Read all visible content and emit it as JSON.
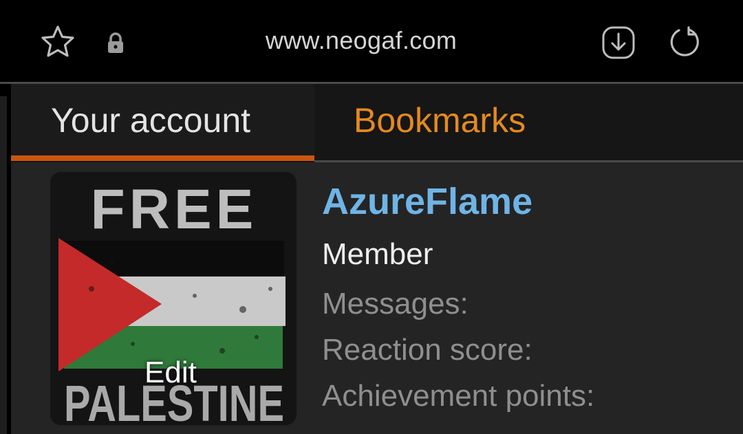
{
  "browser": {
    "url": "www.neogaf.com",
    "icons": {
      "bookmark": "star-outline-icon",
      "secure": "lock-icon",
      "download": "download-circle-icon",
      "reload": "reload-icon"
    }
  },
  "tabs": [
    {
      "label": "Your account",
      "active": true
    },
    {
      "label": "Bookmarks",
      "active": false
    }
  ],
  "profile": {
    "avatar_text_top": "FREE",
    "avatar_text_bottom": "PALESTINE",
    "edit_label": "Edit",
    "username": "AzureFlame",
    "role": "Member",
    "stats": [
      {
        "label": "Messages:"
      },
      {
        "label": "Reaction score:"
      },
      {
        "label": "Achievement points:"
      }
    ]
  },
  "colors": {
    "accent_orange": "#e58a1f",
    "tab_indicator": "#c9560f",
    "username_blue": "#6fb4e6"
  }
}
